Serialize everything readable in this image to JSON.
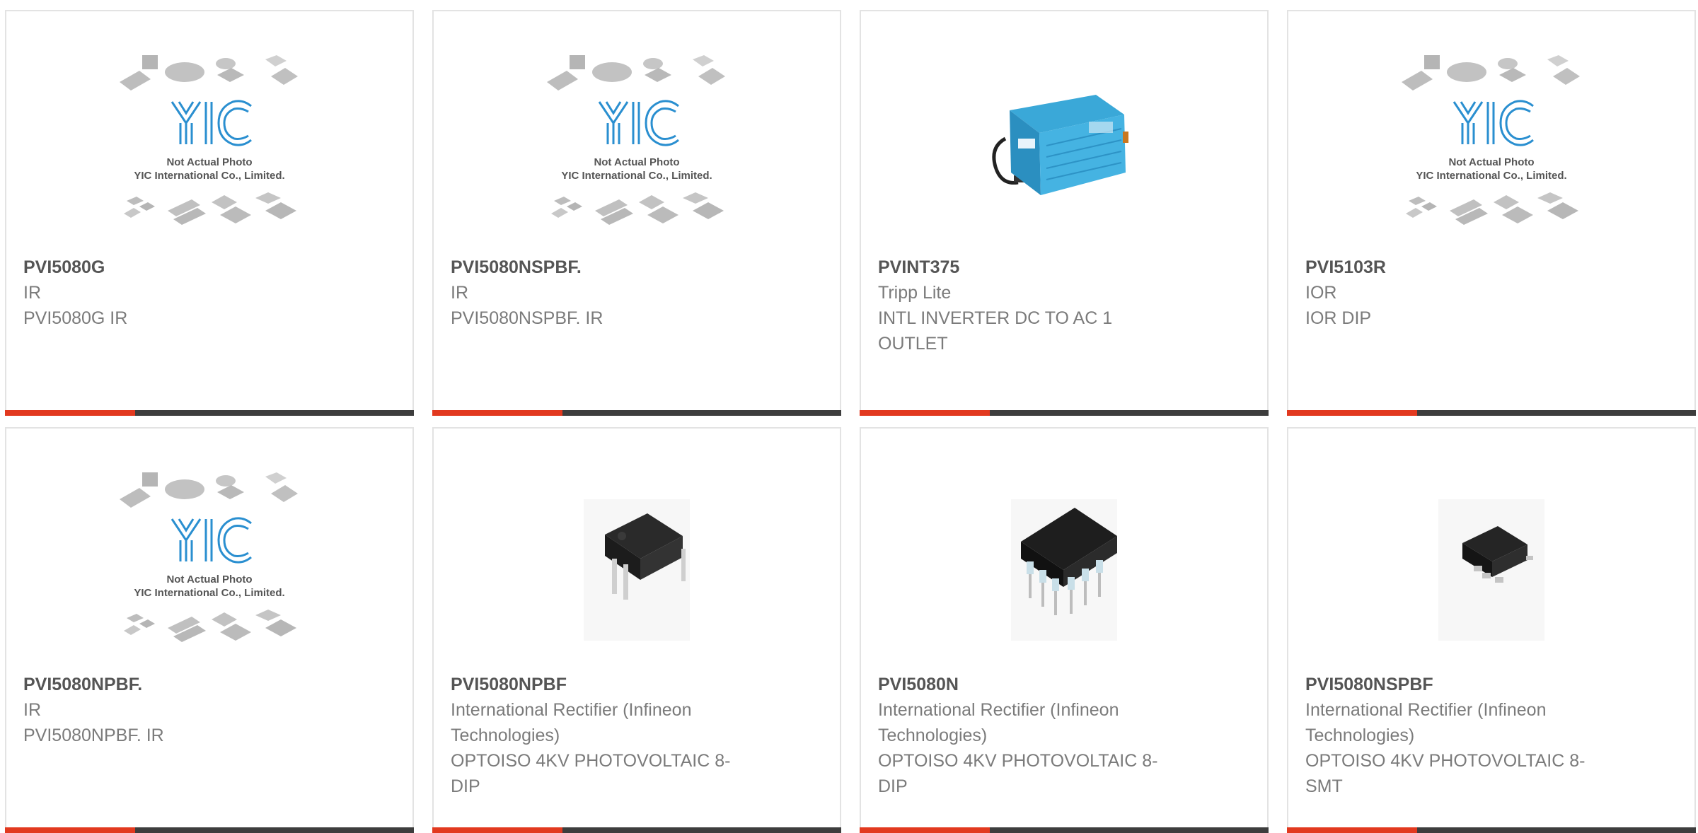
{
  "placeholder": {
    "line1": "Not Actual Photo",
    "line2": "YIC International Co., Limited.",
    "logo": "YIC"
  },
  "colors": {
    "accent": "#e2391f",
    "bar": "#3d3d3d",
    "border": "#e3e3e3",
    "logo": "#2a8fd0"
  },
  "products": [
    {
      "part": "PVI5080G",
      "manufacturer": "IR",
      "description": "PVI5080G IR",
      "image": "placeholder"
    },
    {
      "part": "PVI5080NSPBF.",
      "manufacturer": "IR",
      "description": "PVI5080NSPBF. IR",
      "image": "placeholder"
    },
    {
      "part": "PVINT375",
      "manufacturer": "Tripp Lite",
      "description": "INTL INVERTER DC TO AC 1 OUTLET",
      "image": "inverter"
    },
    {
      "part": "PVI5103R",
      "manufacturer": "IOR",
      "description": "IOR DIP",
      "image": "placeholder"
    },
    {
      "part": "PVI5080NPBF.",
      "manufacturer": "IR",
      "description": "PVI5080NPBF. IR",
      "image": "placeholder"
    },
    {
      "part": "PVI5080NPBF",
      "manufacturer": "International Rectifier (Infineon Technologies)",
      "description": "OPTOISO 4KV PHOTOVOLTAIC 8-DIP",
      "image": "dip-chip"
    },
    {
      "part": "PVI5080N",
      "manufacturer": "International Rectifier (Infineon Technologies)",
      "description": "OPTOISO 4KV PHOTOVOLTAIC 8-DIP",
      "image": "dip8-chip"
    },
    {
      "part": "PVI5080NSPBF",
      "manufacturer": "International Rectifier (Infineon Technologies)",
      "description": "OPTOISO 4KV PHOTOVOLTAIC 8-SMT",
      "image": "smt-chip"
    }
  ]
}
